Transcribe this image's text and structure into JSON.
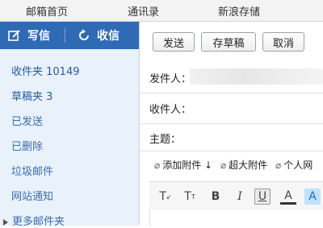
{
  "topnav": {
    "items": [
      "邮箱首页",
      "通讯录",
      "新浪存储"
    ]
  },
  "sidebar": {
    "compose_label": "写信",
    "receive_label": "收信",
    "folders": [
      "收件夹 10149",
      "草稿夹 3",
      "已发送",
      "已删除",
      "垃圾邮件",
      "网站通知"
    ],
    "more_label": "更多邮件夹"
  },
  "toolbar": {
    "send": "发送",
    "save_draft": "存草稿",
    "cancel": "取消"
  },
  "form": {
    "from_label": "发件人：",
    "to_label": "收件人：",
    "subject_label": "主题："
  },
  "attachments": {
    "add": "添加附件 ↓",
    "large": "超大附件",
    "personal": "个人网"
  },
  "format_toolbar": {
    "icons": [
      "clear-format-icon",
      "font-size-icon",
      "bold-icon",
      "italic-icon",
      "underline-icon",
      "font-color-icon",
      "highlight-icon"
    ],
    "glyphs": [
      "T",
      "T",
      "B",
      "I",
      "U",
      "A",
      "A"
    ],
    "active": "underline-icon"
  },
  "colors": {
    "accent": "#2f6ab5",
    "sidebar_bg": "#e9f1fa",
    "link": "#235ea6"
  }
}
